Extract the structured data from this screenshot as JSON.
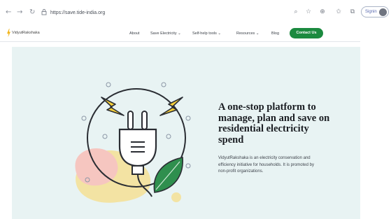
{
  "browser": {
    "url": "https://save.tide-india.org",
    "signin_label": "Signin",
    "icons": [
      "back-icon",
      "forward-icon",
      "reload-icon",
      "lock-icon",
      "search-icon",
      "bookmark-star-icon",
      "extensions-icon",
      "favorites-icon",
      "collections-icon",
      "profile-icon"
    ]
  },
  "site": {
    "logo_text": "VidyutRakshaka",
    "menu": [
      {
        "label": "About"
      },
      {
        "label": "Save Electricity ⌄"
      },
      {
        "label": "Self-help tools ⌄"
      },
      {
        "label": "Resources ⌄"
      },
      {
        "label": "Blog"
      }
    ],
    "contact_label": "Contact Us"
  },
  "hero": {
    "title": "A one-stop platform to manage, plan and save on residential electricity spend",
    "description": "VidyutRakshaka is an electricity conservation and efficiency initiative for households. It is promoted by non-profit organizations."
  },
  "colors": {
    "accent_green": "#1b8a3f",
    "hero_bg": "#e8f3f3",
    "bolt_yellow": "#f6cf3a",
    "blob_pink": "#f6c6c0",
    "blob_yellow": "#f3e3a3",
    "leaf_green": "#2f8f4e"
  }
}
